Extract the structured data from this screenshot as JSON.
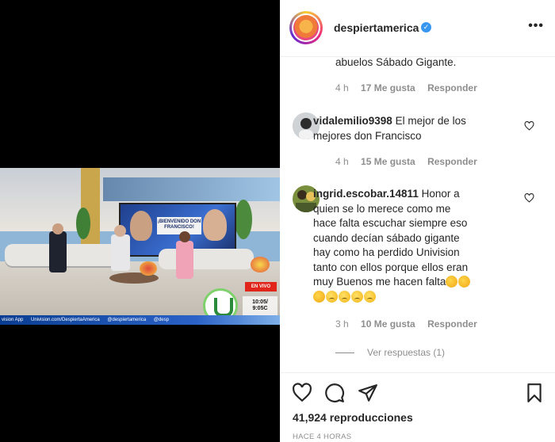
{
  "video": {
    "screen_banner": "¡BIENVENIDO DON FRANCISCO!",
    "live_badge": "EN VIVO",
    "clock_time": "10:05/",
    "clock_time2": "9:05C",
    "ticker": [
      "vision App",
      "Univision.com/DespiertaAmerica",
      "@despiertamerica",
      "@desp"
    ]
  },
  "header": {
    "username": "despiertamerica",
    "more_label": "•••",
    "verified_symbol": "✓"
  },
  "comments": {
    "partial": {
      "text": "abuelos Sábado Gigante.",
      "time": "4 h",
      "likes": "17 Me gusta",
      "reply": "Responder"
    },
    "items": [
      {
        "user": "vidalemilio9398",
        "text_line1": " El mejor de los",
        "text_line2": "mejores don Francisco",
        "time": "4 h",
        "likes": "15 Me gusta",
        "reply": "Responder"
      },
      {
        "user": "ingrid.escobar.14811",
        "text_line1": " Honor a",
        "text_line2": "quien se lo merece como me",
        "text_line3": "hace falta escuchar siempre eso",
        "text_line4": "cuando decían sábado gigante",
        "text_line5": "hay como ha perdido Univision",
        "text_line6": "tanto con ellos porque ellos eran",
        "text_line7": "muy Buenos me hacen falta",
        "time": "3 h",
        "likes": "10 Me gusta",
        "reply": "Responder",
        "view_replies": "Ver respuestas (1)"
      }
    ]
  },
  "footer": {
    "views_count": "41,924",
    "views_label": "reproducciones",
    "posted": "HACE 4 HORAS"
  },
  "icons": {
    "like": "heart-icon",
    "comment": "comment-icon",
    "share": "share-icon",
    "save": "bookmark-icon"
  }
}
